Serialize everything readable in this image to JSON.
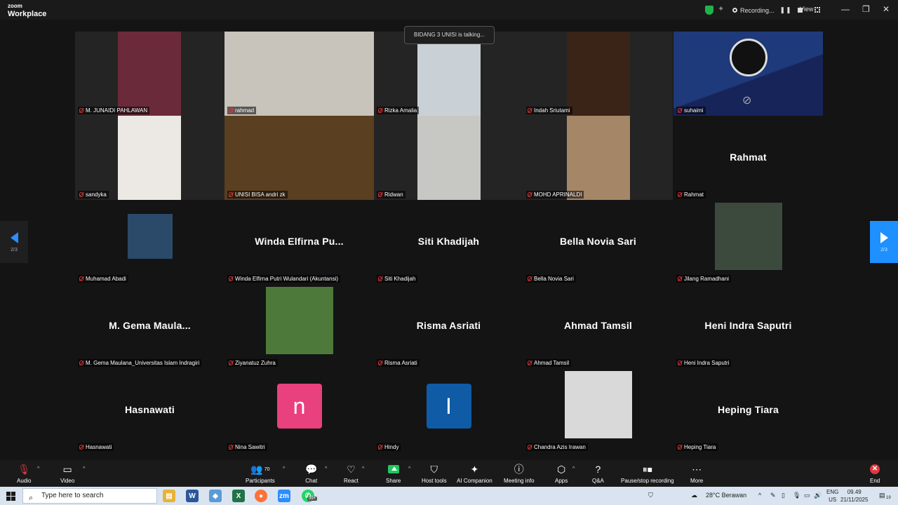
{
  "app": {
    "title_line1": "zoom",
    "title_line2": "Workplace"
  },
  "topbar": {
    "recording_label": "Recording...",
    "pause_icon": "pause-icon",
    "stop_icon": "stop-icon",
    "view_label": "View"
  },
  "talking": "BIDANG 3 UNISI is talking...",
  "pager": {
    "prev_label": "2/3",
    "next_label": "2/3"
  },
  "tiles": [
    {
      "name": "M. JUNAIDI PAHLAWAN",
      "type": "video",
      "bg": "#6b2a3a"
    },
    {
      "name": "rahmad",
      "type": "video",
      "bg": "#c8c4bb"
    },
    {
      "name": "Rizka Amalia",
      "type": "video",
      "bg": "#c9d1d6"
    },
    {
      "name": "Indah Sriutami",
      "type": "video",
      "bg": "#3a2418"
    },
    {
      "name": "suhaimi",
      "type": "obs",
      "bg": "#1f3a7a"
    },
    {
      "name": "sandyka",
      "type": "video",
      "bg": "#ece8e3"
    },
    {
      "name": "UNISI BISA andri zk",
      "type": "video",
      "bg": "#5a3f20"
    },
    {
      "name": "Ridwan",
      "type": "video",
      "bg": "#c7c7c4"
    },
    {
      "name": "MOHD APRINALDI",
      "type": "video",
      "bg": "#a58666"
    },
    {
      "name": "Rahmat",
      "type": "text",
      "label": "Rahmat"
    },
    {
      "name": "Muhamad Abadi",
      "type": "pic",
      "bg": "#2b4a6a",
      "size": 64
    },
    {
      "name": "Winda Elfirna Putri Wulandari (Akuntansi)",
      "type": "text",
      "label": "Winda  Elfirna  Pu..."
    },
    {
      "name": "Siti Khadijah",
      "type": "text",
      "label": "Siti Khadijah"
    },
    {
      "name": "Bella Novia Sari",
      "type": "text",
      "label": "Bella Novia Sari"
    },
    {
      "name": "Jilang Ramadhani",
      "type": "pic",
      "bg": "#3b4a3c",
      "size": 96
    },
    {
      "name": "M. Gema Maulana_Universitas Islam Indragiri",
      "type": "text",
      "label": "M. Gema Maula..."
    },
    {
      "name": "Ziyanatuz Zuhra",
      "type": "pic",
      "bg": "#4d7a3a",
      "size": 96
    },
    {
      "name": "Risma Asriati",
      "type": "text",
      "label": "Risma Asriati"
    },
    {
      "name": "Ahmad Tamsil",
      "type": "text",
      "label": "Ahmad Tamsil"
    },
    {
      "name": "Heni Indra Saputri",
      "type": "text",
      "label": "Heni Indra Saputri"
    },
    {
      "name": "Hasnawati",
      "type": "text",
      "label": "Hasnawati"
    },
    {
      "name": "Nina Sawitri",
      "type": "avatar",
      "letter": "n",
      "bg": "#e8417d"
    },
    {
      "name": "Hindy",
      "type": "avatar",
      "letter": "I",
      "bg": "#0f5ba6"
    },
    {
      "name": "Chandra Azis Irawan",
      "type": "pic",
      "bg": "#d9d9d9",
      "size": 96
    },
    {
      "name": "Heping Tiara",
      "type": "text",
      "label": "Heping Tiara"
    }
  ],
  "toolbar": {
    "audio": "Audio",
    "video": "Video",
    "participants": "Participants",
    "participants_count": "70",
    "chat": "Chat",
    "react": "React",
    "share": "Share",
    "host_tools": "Host tools",
    "ai_companion": "AI Companion",
    "meeting_info": "Meeting info",
    "apps": "Apps",
    "qa": "Q&A",
    "recording": "Pause/stop recording",
    "more": "More",
    "end": "End"
  },
  "taskbar": {
    "search_placeholder": "Type here to search",
    "weather": "28°C  Berawan",
    "lang1": "ENG",
    "lang2": "US",
    "time": "09.49",
    "date": "21/11/2025",
    "notif_count": "19",
    "apps_badge": "99+"
  },
  "colors": {
    "accent": "#1e90ff",
    "share_green": "#22c55e",
    "end_red": "#e0383e"
  }
}
